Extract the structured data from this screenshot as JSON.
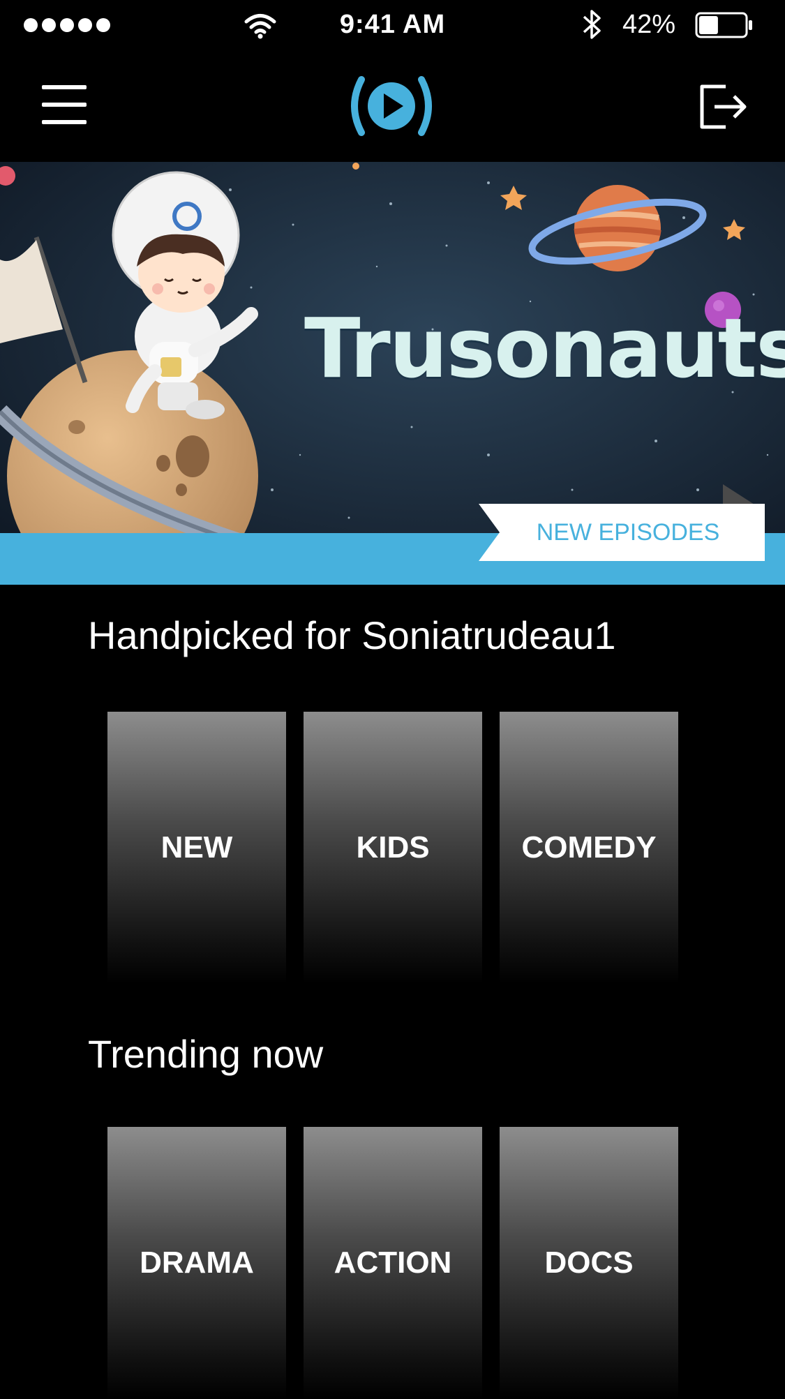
{
  "status_bar": {
    "time": "9:41 AM",
    "battery_percent": "42%",
    "battery_level": 0.42,
    "signal_bars": 5
  },
  "nav": {
    "menu_icon": "hamburger-menu-icon",
    "logo_icon": "play-logo-icon",
    "logout_icon": "logout-icon",
    "accent_color": "#47b1dd"
  },
  "hero": {
    "title": "Trusonauts",
    "badge_label": "NEW EPISODES"
  },
  "sections": [
    {
      "title": "Handpicked for Soniatrudeau1",
      "tiles": [
        "NEW",
        "KIDS",
        "COMEDY"
      ]
    },
    {
      "title": "Trending now",
      "tiles": [
        "DRAMA",
        "ACTION",
        "DOCS"
      ]
    }
  ]
}
